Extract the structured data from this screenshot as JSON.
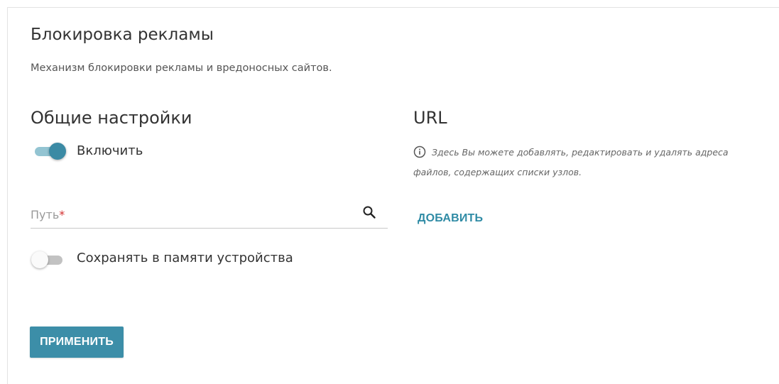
{
  "page": {
    "title": "Блокировка рекламы",
    "description": "Механизм блокировки рекламы и вредоносных сайтов."
  },
  "general": {
    "title": "Общие настройки",
    "enable_toggle": {
      "label": "Включить",
      "state": "on"
    },
    "path_field": {
      "placeholder": "Путь",
      "required_mark": "*",
      "value": ""
    },
    "save_toggle": {
      "label": "Сохранять в памяти устройства",
      "state": "off"
    }
  },
  "url": {
    "title": "URL",
    "info": "Здесь Вы можете добавлять, редактировать и удалять адреса файлов, содержащих списки узлов.",
    "add_button": "ДОБАВИТЬ"
  },
  "actions": {
    "apply_button": "ПРИМЕНИТЬ"
  },
  "colors": {
    "accent": "#3c8ea8",
    "toggle_on_track": "#93c4d2",
    "toggle_on_knob": "#3b8aa4",
    "required": "#d32f2f"
  },
  "icons": {
    "search": "search-icon",
    "info": "info-icon"
  }
}
